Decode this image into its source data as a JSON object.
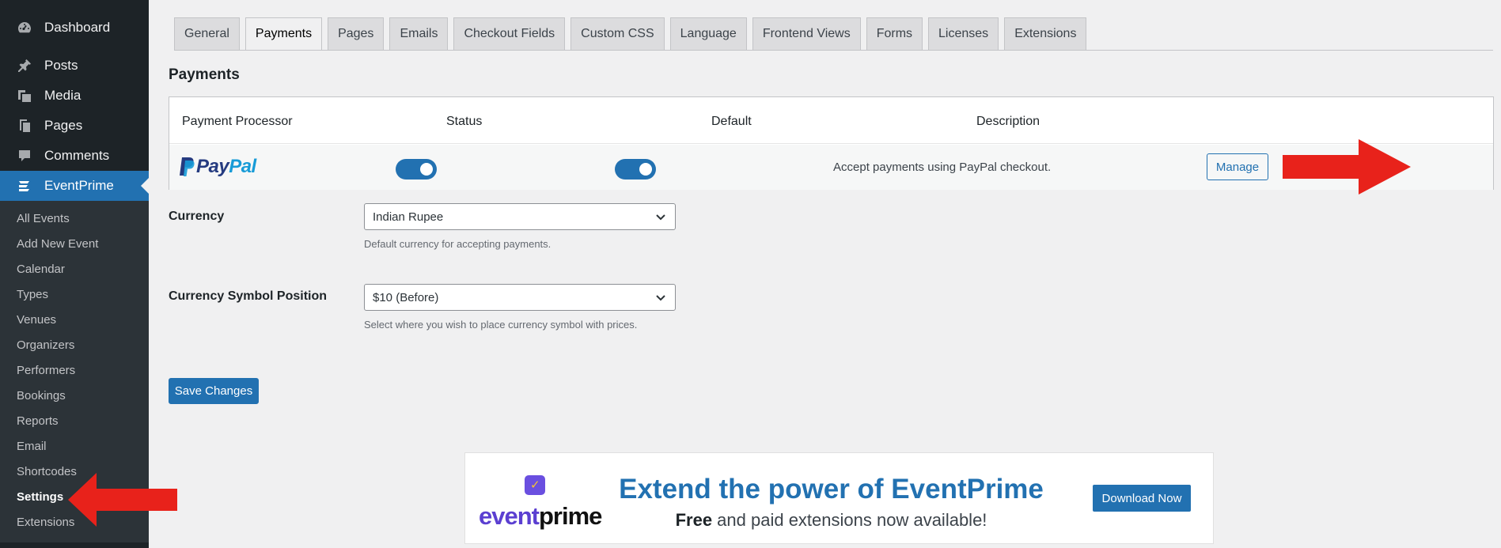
{
  "sidebar": {
    "top_items": [
      {
        "label": "Dashboard",
        "icon": "dashboard-icon"
      },
      {
        "label": "Posts",
        "icon": "pin-icon"
      },
      {
        "label": "Media",
        "icon": "media-icon"
      },
      {
        "label": "Pages",
        "icon": "pages-icon"
      },
      {
        "label": "Comments",
        "icon": "comment-icon"
      },
      {
        "label": "EventPrime",
        "icon": "eventprime-icon"
      }
    ],
    "submenu": [
      "All Events",
      "Add New Event",
      "Calendar",
      "Types",
      "Venues",
      "Organizers",
      "Performers",
      "Bookings",
      "Reports",
      "Email",
      "Shortcodes",
      "Settings",
      "Extensions"
    ]
  },
  "tabs": [
    "General",
    "Payments",
    "Pages",
    "Emails",
    "Checkout Fields",
    "Custom CSS",
    "Language",
    "Frontend Views",
    "Forms",
    "Licenses",
    "Extensions"
  ],
  "active_tab": "Payments",
  "section_title": "Payments",
  "payment_table": {
    "headers": {
      "processor": "Payment Processor",
      "status": "Status",
      "default": "Default",
      "description": "Description"
    },
    "rows": [
      {
        "processor_logo": {
          "pay": "Pay",
          "pal": "Pal"
        },
        "status_on": true,
        "default_on": true,
        "description": "Accept payments using PayPal checkout.",
        "action": "Manage"
      }
    ]
  },
  "currency": {
    "label": "Currency",
    "value": "Indian Rupee",
    "help": "Default currency for accepting payments."
  },
  "currency_position": {
    "label": "Currency Symbol Position",
    "value": "$10 (Before)",
    "help": "Select where you wish to place currency symbol with prices."
  },
  "save_label": "Save Changes",
  "banner": {
    "logo": {
      "ev": "event",
      "pr": "prime"
    },
    "title": "Extend the power of EventPrime",
    "subtitle_bold": "Free",
    "subtitle_rest": " and paid extensions now available!",
    "button": "Download Now"
  },
  "colors": {
    "accent": "#2271b1",
    "sidebar_bg": "#1d2327",
    "arrow": "#e8221b"
  }
}
